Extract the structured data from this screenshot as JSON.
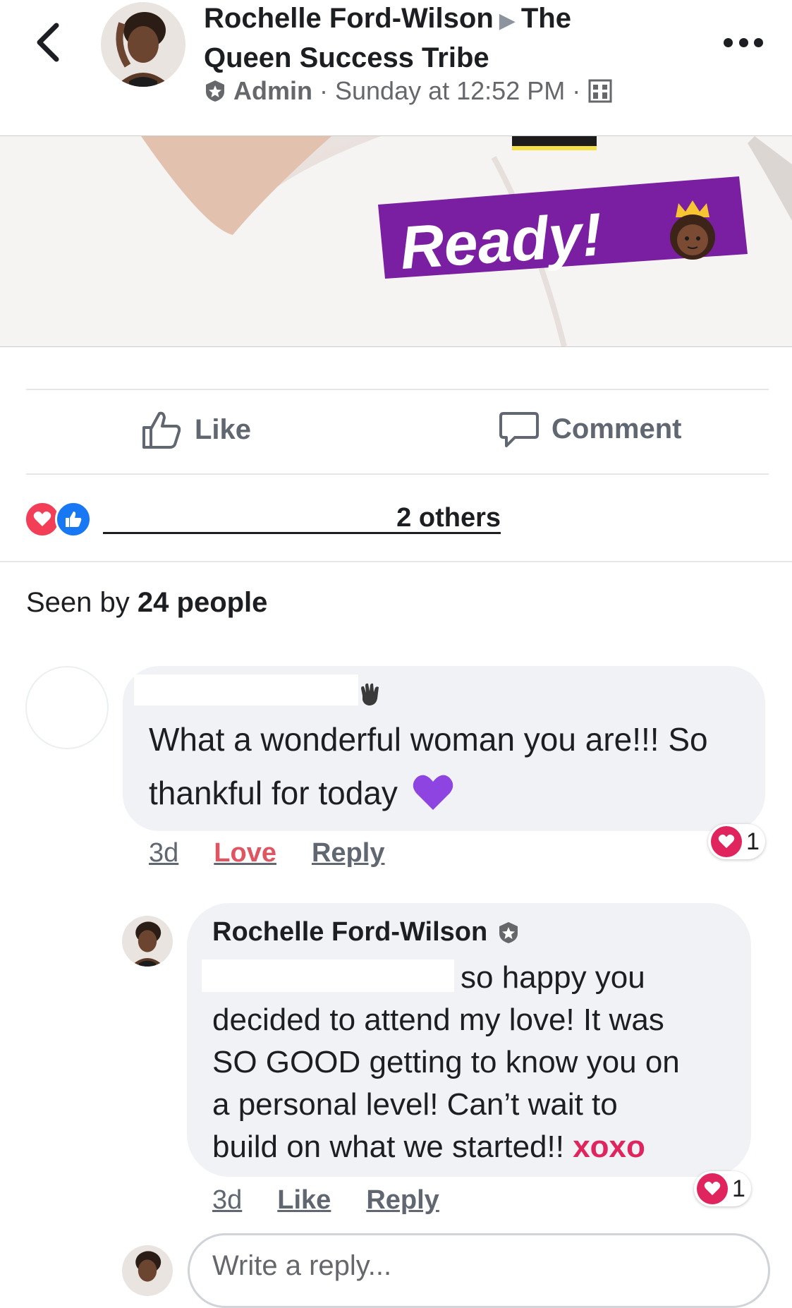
{
  "header": {
    "author": "Rochelle Ford-Wilson",
    "group_part1": "The",
    "group_part2": "Queen Success Tribe",
    "role": "Admin",
    "separator": "·",
    "timestamp": "Sunday at 12:52 PM"
  },
  "photo": {
    "caption": "Ready!"
  },
  "actions": {
    "like_label": "Like",
    "comment_label": "Comment"
  },
  "reactions": {
    "others_text": "2 others"
  },
  "seen": {
    "prefix": "Seen by",
    "count_text": "24 people"
  },
  "comments": [
    {
      "line1": "What a wonderful woman you are!!! So",
      "line2": "thankful for today",
      "time": "3d",
      "reaction_label": "Love",
      "reply_label": "Reply",
      "reaction_count": "1"
    },
    {
      "author": "Rochelle Ford-Wilson",
      "line1": "so happy you",
      "line2": "decided to attend my love! It was",
      "line3": "SO GOOD getting to know you on",
      "line4": "a personal level! Can’t wait to",
      "line5": "build on what we started!!",
      "signoff": "xoxo",
      "time": "3d",
      "like_label": "Like",
      "reply_label": "Reply",
      "reaction_count": "1"
    }
  ],
  "reply_box": {
    "placeholder": "Write a reply..."
  },
  "colors": {
    "accent_purple": "#7b1fa2",
    "love_red": "#e0245e",
    "like_blue": "#1877f2",
    "text_gray": "#65676b"
  }
}
